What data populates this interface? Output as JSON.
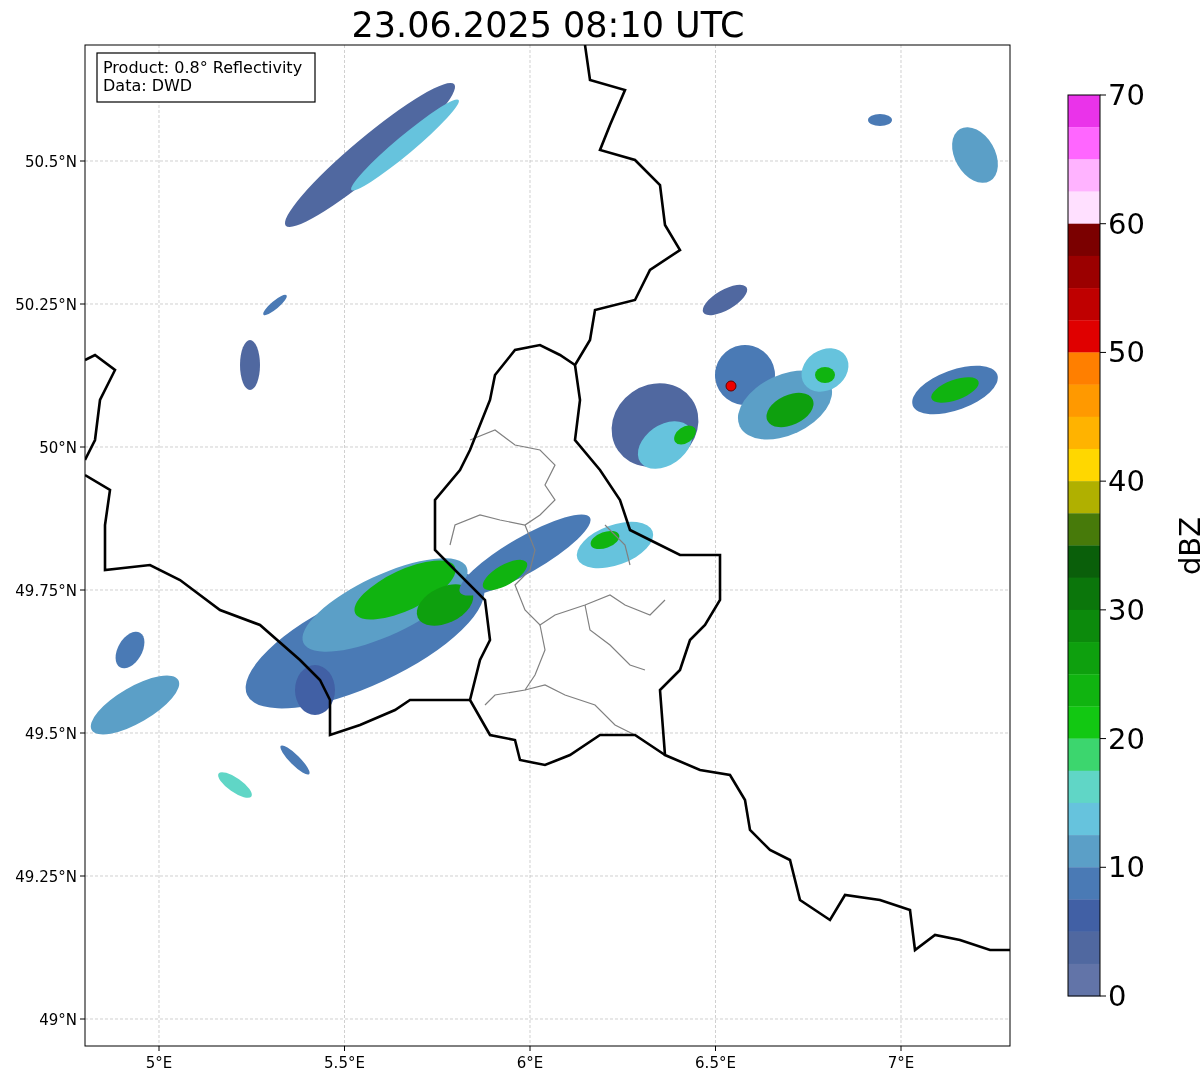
{
  "title": "23.06.2025 08:10 UTC",
  "info_box": {
    "lines": [
      "Product: 0.8° Reflectivity",
      "Data: DWD"
    ]
  },
  "map": {
    "y_ticks": [
      "50.5°N",
      "50.25°N",
      "50°N",
      "49.75°N",
      "49.5°N",
      "49.25°N",
      "49°N"
    ],
    "x_ticks": [
      "5°E",
      "5.5°E",
      "6°E",
      "6.5°E",
      "7°E"
    ]
  },
  "colorbar": {
    "label": "dBZ",
    "ticks": [
      "70",
      "60",
      "50",
      "40",
      "30",
      "20",
      "10",
      "0"
    ],
    "bins": [
      {
        "color": "#ea33ea"
      },
      {
        "color": "#ff66ff"
      },
      {
        "color": "#ffb3ff"
      },
      {
        "color": "#ffe0ff"
      },
      {
        "color": "#7b0000"
      },
      {
        "color": "#9b0000"
      },
      {
        "color": "#bf0000"
      },
      {
        "color": "#e00000"
      },
      {
        "color": "#ff7f00"
      },
      {
        "color": "#ff9900"
      },
      {
        "color": "#ffb300"
      },
      {
        "color": "#ffd700"
      },
      {
        "color": "#b0b000"
      },
      {
        "color": "#477a0a"
      },
      {
        "color": "#0a5f0a"
      },
      {
        "color": "#0b760b"
      },
      {
        "color": "#0c8a0c"
      },
      {
        "color": "#0ea00e"
      },
      {
        "color": "#10b410"
      },
      {
        "color": "#12c812"
      },
      {
        "color": "#3cd66e"
      },
      {
        "color": "#60d6c6"
      },
      {
        "color": "#66c3dd"
      },
      {
        "color": "#5b9fc7"
      },
      {
        "color": "#4a7ab5"
      },
      {
        "color": "#4160a5"
      },
      {
        "color": "#5068a0"
      },
      {
        "color": "#6274a8"
      }
    ]
  }
}
